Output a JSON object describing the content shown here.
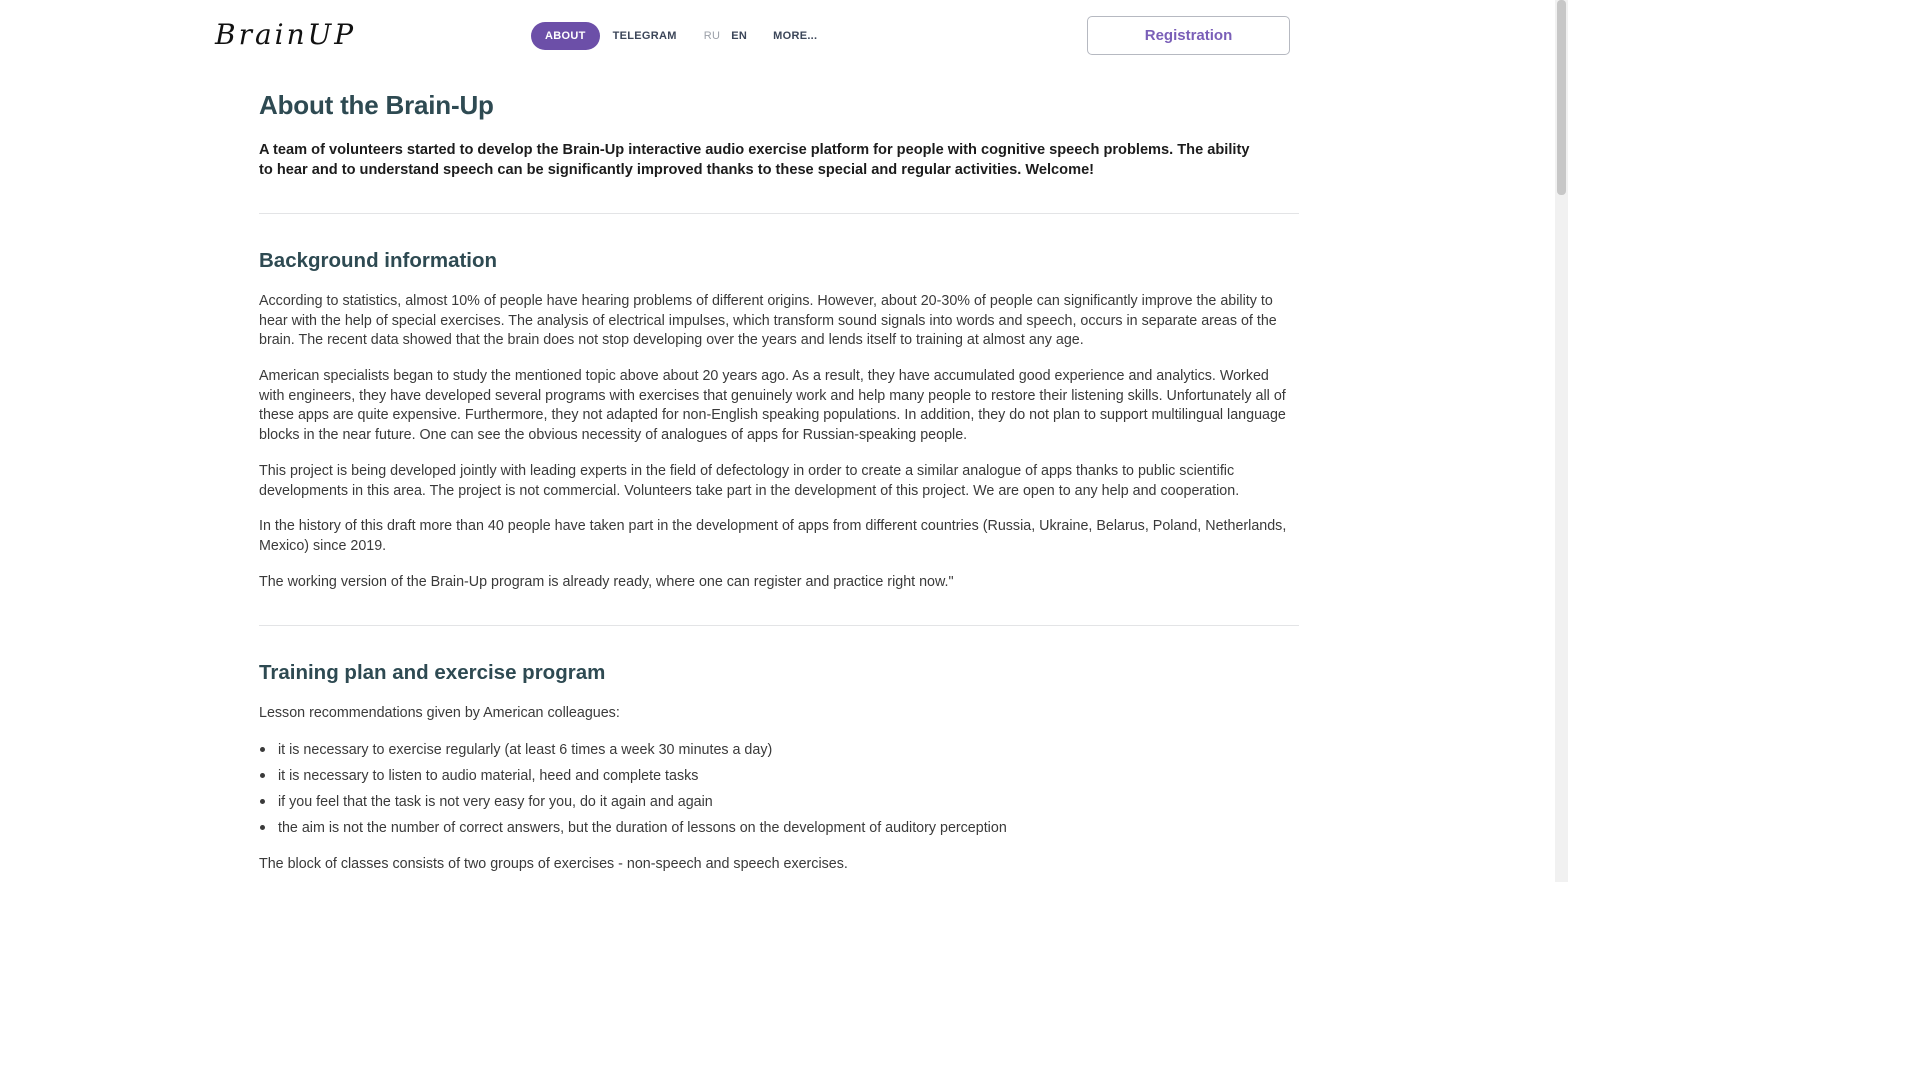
{
  "header": {
    "logo": "BrainUP",
    "nav": {
      "about": "ABOUT",
      "telegram": "TELEGRAM",
      "ru": "RU",
      "en": "EN",
      "more": "MORE..."
    },
    "registration": "Registration",
    "active_color": "#6c4fa8"
  },
  "main": {
    "title": "About the Brain-Up",
    "lead": "A team of volunteers started to develop the Brain-Up interactive audio exercise platform for people with cognitive speech problems. The ability to hear and to understand speech can be significantly improved thanks to these special and regular activities. Welcome!",
    "background": {
      "title": "Background information",
      "paragraphs": [
        "According to statistics, almost 10% of people have hearing problems of different origins. However, about 20-30% of people can significantly improve the ability to hear with the help of special exercises. The analysis of electrical impulses, which transform sound signals into words and speech, occurs in separate areas of the brain. The recent data showed that the brain does not stop developing over the years and lends itself to training at almost any age.",
        "American specialists began to study the mentioned topic above about 20 years ago. As a result, they have accumulated good experience and analytics. Worked with engineers, they have developed several programs with exercises that genuinely work and help many people to restore their listening skills. Unfortunately all of these apps are quite expensive. Furthermore, they not adapted for non-English speaking populations. In addition, they do not plan to support multilingual language blocks in the near future. One can see the obvious necessity of analogues of apps for Russian-speaking people.",
        "This project is being developed jointly with leading experts in the field of defectology in order to create a similar analogue of apps thanks to public scientific developments in this area. The project is not commercial. Volunteers take part in the development of this project. We are open to any help and cooperation.",
        "In the history of this draft more than 40 people have taken part in the development of apps from different countries (Russia, Ukraine, Belarus, Poland, Netherlands, Mexico) since 2019.",
        "The working version of the Brain-Up program is already ready, where one can register and practice right now.\""
      ]
    },
    "training": {
      "title": "Training plan and exercise program",
      "intro": "Lesson recommendations given by American colleagues:",
      "items": [
        "it is necessary to exercise regularly (at least 6 times a week 30 minutes a day)",
        "it is necessary to listen to audio material, heed and complete tasks",
        "if you feel that the task is not very easy for you, do it again and again",
        "the aim is not the number of correct answers, but the duration of lessons on the development of auditory perception"
      ],
      "outro": "The block of classes consists of two groups of exercises - non-speech and speech exercises."
    }
  }
}
